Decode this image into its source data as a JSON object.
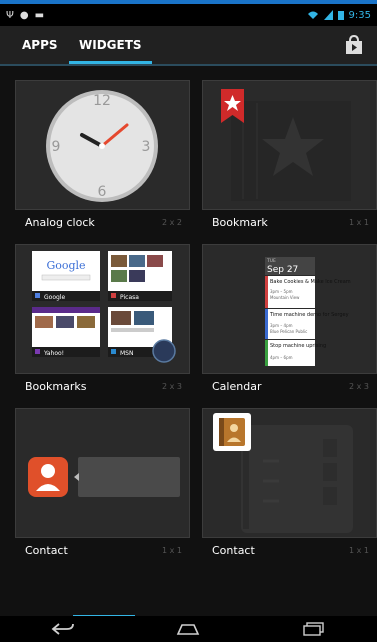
{
  "status": {
    "time": "9:35"
  },
  "tabs": [
    {
      "label": "APPS"
    },
    {
      "label": "WIDGETS"
    }
  ],
  "widgets": [
    {
      "name": "Analog clock",
      "size": "2 x 2"
    },
    {
      "name": "Bookmark",
      "size": "1 x 1"
    },
    {
      "name": "Bookmarks",
      "size": "2 x 3"
    },
    {
      "name": "Calendar",
      "size": "2 x 3"
    },
    {
      "name": "Contact",
      "size": "1 x 1"
    },
    {
      "name": "Contact",
      "size": "1 x 1"
    }
  ],
  "clock": {
    "numbers": [
      "12",
      "3",
      "6",
      "9"
    ]
  },
  "bookmarks_preview": [
    {
      "title": "Google"
    },
    {
      "title": "Picasa"
    },
    {
      "title": "Yahoo!"
    },
    {
      "title": "MSN"
    }
  ],
  "calendar_preview": {
    "day": "TUE",
    "date": "Sep 27",
    "events": [
      {
        "title": "Bake Cookies & Make Ice Cream",
        "time": "3pm – 5pm",
        "place": "Mountain View"
      },
      {
        "title": "Time machine demo for Sergey",
        "time": "3pm – 4pm",
        "place": "Blue Pelican Public"
      },
      {
        "title": "Stop machine uprising",
        "time": "4pm – 6pm",
        "place": ""
      }
    ]
  },
  "colors": {
    "accent": "#33b5e5",
    "bookmark_red": "#d02a2a",
    "contact_orange": "#e0502a"
  }
}
